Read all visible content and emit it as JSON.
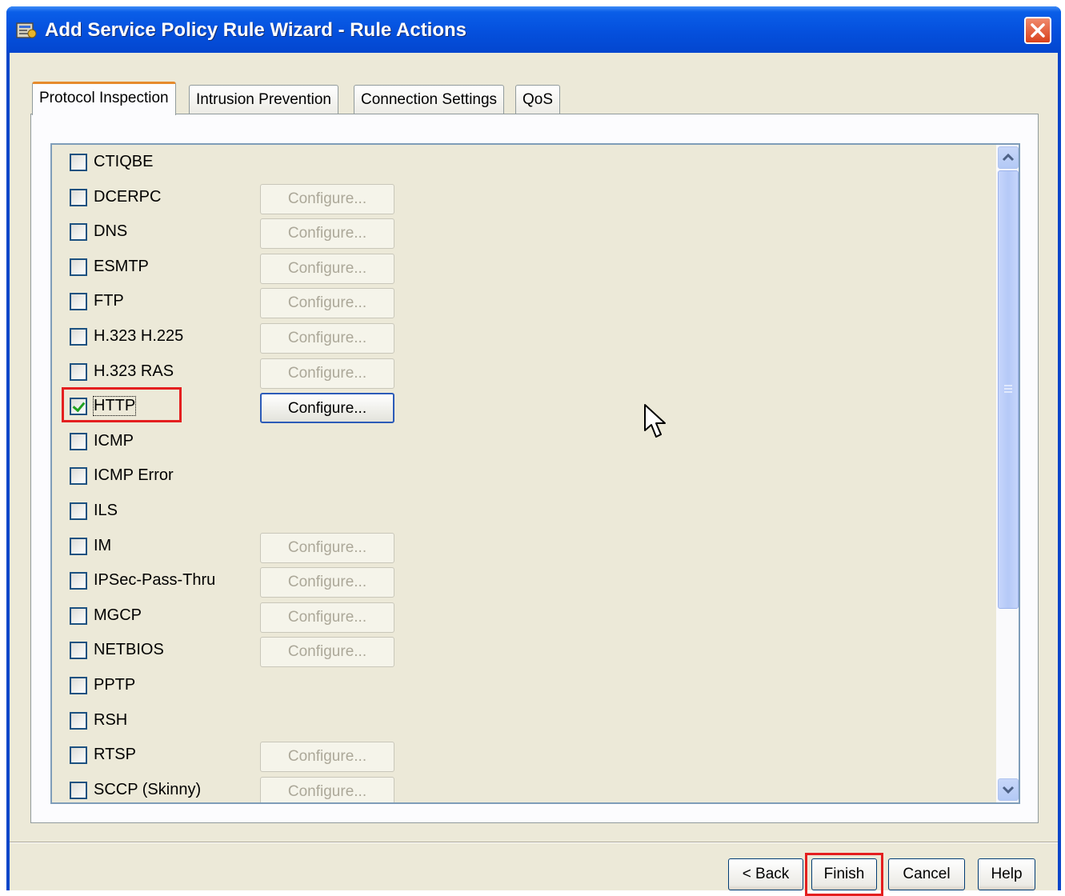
{
  "window": {
    "title": "Add Service Policy Rule Wizard - Rule Actions"
  },
  "tabs": [
    {
      "label": "Protocol Inspection",
      "active": true
    },
    {
      "label": "Intrusion Prevention",
      "active": false
    },
    {
      "label": "Connection Settings",
      "active": false
    },
    {
      "label": "QoS",
      "active": false
    }
  ],
  "configure_label": "Configure...",
  "protocols": [
    {
      "name": "CTIQBE",
      "checked": false,
      "configure": "none"
    },
    {
      "name": "DCERPC",
      "checked": false,
      "configure": "disabled"
    },
    {
      "name": "DNS",
      "checked": false,
      "configure": "disabled"
    },
    {
      "name": "ESMTP",
      "checked": false,
      "configure": "disabled"
    },
    {
      "name": "FTP",
      "checked": false,
      "configure": "disabled"
    },
    {
      "name": "H.323 H.225",
      "checked": false,
      "configure": "disabled"
    },
    {
      "name": "H.323 RAS",
      "checked": false,
      "configure": "disabled"
    },
    {
      "name": "HTTP",
      "checked": true,
      "configure": "enabled"
    },
    {
      "name": "ICMP",
      "checked": false,
      "configure": "none"
    },
    {
      "name": "ICMP Error",
      "checked": false,
      "configure": "none"
    },
    {
      "name": "ILS",
      "checked": false,
      "configure": "none"
    },
    {
      "name": "IM",
      "checked": false,
      "configure": "disabled"
    },
    {
      "name": "IPSec-Pass-Thru",
      "checked": false,
      "configure": "disabled"
    },
    {
      "name": "MGCP",
      "checked": false,
      "configure": "disabled"
    },
    {
      "name": "NETBIOS",
      "checked": false,
      "configure": "disabled"
    },
    {
      "name": "PPTP",
      "checked": false,
      "configure": "none"
    },
    {
      "name": "RSH",
      "checked": false,
      "configure": "none"
    },
    {
      "name": "RTSP",
      "checked": false,
      "configure": "disabled"
    },
    {
      "name": "SCCP (Skinny)",
      "checked": false,
      "configure": "disabled"
    }
  ],
  "footer": {
    "back_label": "< Back",
    "finish_label": "Finish",
    "cancel_label": "Cancel",
    "help_label": "Help"
  },
  "colors": {
    "title_bar": "#0550dd",
    "highlight": "#e41f1f",
    "dialog_bg": "#ece9d8"
  }
}
